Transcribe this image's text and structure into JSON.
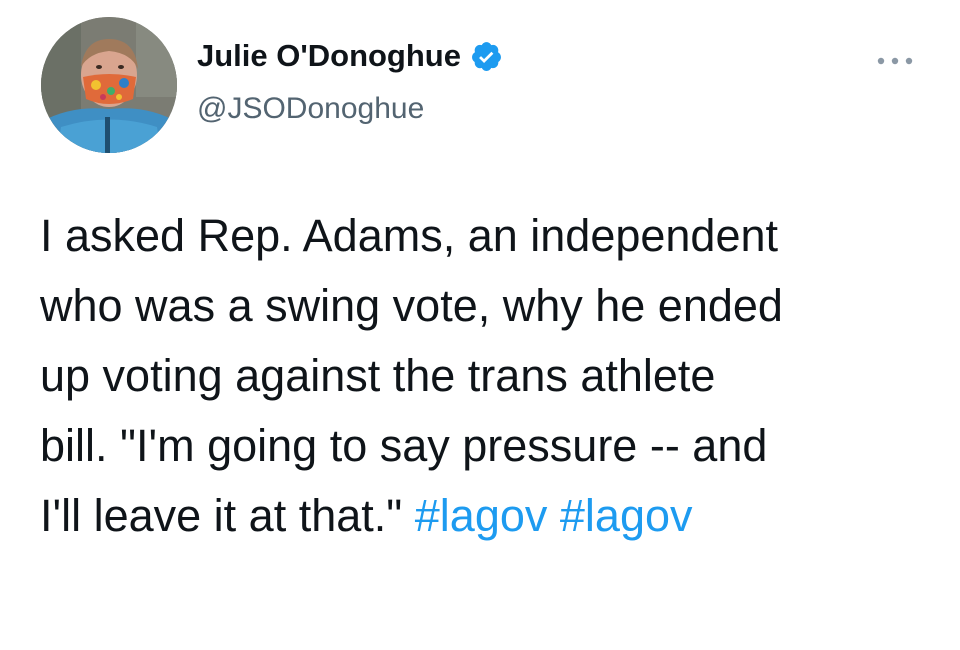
{
  "author": {
    "name": "Julie O'Donoghue",
    "handle": "@JSODonoghue",
    "verified": true
  },
  "tweet": {
    "lines": [
      "I asked Rep. Adams, an independent",
      "who was a swing vote, why he ended",
      "up voting against the trans athlete",
      "bill. \"I'm going to say pressure -- and",
      "I'll leave it at that.\""
    ],
    "hashtags": [
      "#lagov",
      "#lagov"
    ]
  },
  "icons": {
    "more": "more-horizontal-icon",
    "verified": "verified-badge-icon"
  },
  "colors": {
    "text": "#0f1419",
    "secondary": "#536471",
    "link": "#1d9bf0",
    "verified": "#1d9bf0"
  }
}
